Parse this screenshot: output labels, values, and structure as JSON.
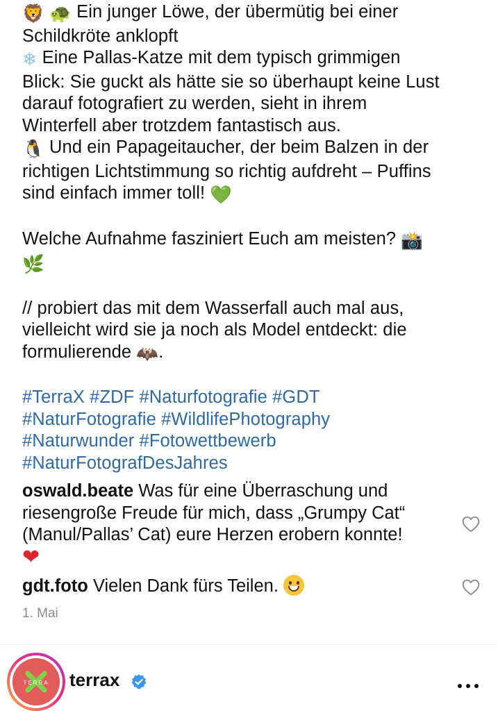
{
  "caption": {
    "line1_text": " Ein junger Löwe, der übermütig bei einer",
    "line2_text": "Schildkröte anklopft",
    "line3_text": " Eine Pallas-Katze mit dem typisch grimmigen",
    "line4_text": "Blick: Sie guckt als hätte sie so überhaupt keine Lust",
    "line5_text": "darauf fotografiert zu werden, sieht in ihrem",
    "line6_text": "Winterfell aber trotzdem fantastisch aus.",
    "line7_text": " Und ein Papageitaucher, der beim Balzen in der",
    "line8_text": "richtigen Lichtstimmung so richtig aufdreht – Puffins",
    "line9_text": "sind einfach immer toll! ",
    "question_text": "Welche Aufnahme fasziniert Euch am meisten? ",
    "signoff_line1": "// probiert das mit dem Wasserfall auch mal aus,",
    "signoff_line2": "vielleicht wird sie ja noch als Model entdeckt: die",
    "signoff_line3": "formulierende ",
    "signoff_end": ".",
    "hashtags_line1": "#TerraX #ZDF #Naturfotografie #GDT",
    "hashtags_line2": "#NaturFotografie #WildlifePhotography",
    "hashtags_line3": "#Naturwunder #Fotowettbewerb",
    "hashtags_line4": "#NaturFotografDesJahres",
    "emoji": {
      "lion": "🦁",
      "turtle": "🐢",
      "snowflake": "❄",
      "puffin": "🐧",
      "green_heart": "💚",
      "camera": "📸",
      "herb": "🌿",
      "bat": "🦇"
    }
  },
  "comments": [
    {
      "user": "oswald.beate",
      "line1": " Was für eine Überraschung und",
      "line2": "riesengroße Freude für mich, dass „Grumpy Cat“",
      "line3": "(Manul/Pallas’ Cat) eure Herzen erobern konnte!",
      "emoji": "❤"
    },
    {
      "user": "gdt.foto",
      "text": " Vielen Dank fürs Teilen. "
    }
  ],
  "post_date": "1. Mai",
  "account": {
    "username": "terrax",
    "avatar_text": "TERRA"
  },
  "colors": {
    "hashtag": "#2d6aa3",
    "verified": "#3897f0",
    "date": "#8a8a8a"
  },
  "icons": [
    "heart-outline-icon",
    "verified-badge-icon",
    "more-options-icon"
  ]
}
